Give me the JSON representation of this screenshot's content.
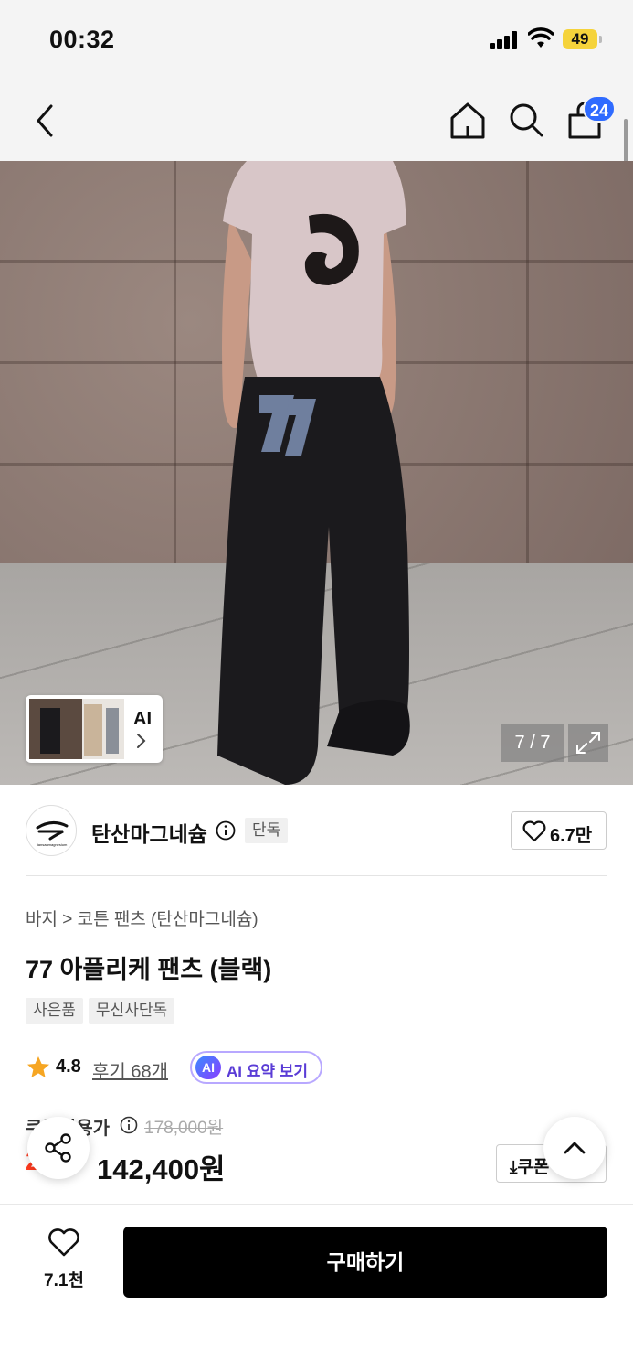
{
  "status_bar": {
    "time": "00:32",
    "battery": "49"
  },
  "header": {
    "cart_count": "24"
  },
  "gallery": {
    "counter": "7 / 7",
    "ai_label": "AI"
  },
  "brand": {
    "name": "탄산마그네슘",
    "exclusive_tag": "단독",
    "likes": "6.7만",
    "logo_text": "tansanmagnesium"
  },
  "product": {
    "breadcrumb": "바지 > 코튼 팬츠 (탄산마그네슘)",
    "title": "77 아플리케 팬츠 (블랙)",
    "tags": [
      "사은품",
      "무신사단독"
    ],
    "rating": "4.8",
    "reviews": "후기 68개",
    "ai_summary": "AI 요약 보기",
    "ai_badge": "AI",
    "price_label": "쿠폰적용가",
    "original_price": "178,000원",
    "discount": "20%",
    "price": "142,400원",
    "coupon_button": "쿠폰"
  },
  "bottom_bar": {
    "wish_count": "7.1천",
    "buy_label": "구매하기"
  },
  "colors": {
    "accent": "#2f6bff",
    "discount": "#ff3a1e",
    "ai": "#5a3cd6",
    "battery": "#f5d33b"
  }
}
